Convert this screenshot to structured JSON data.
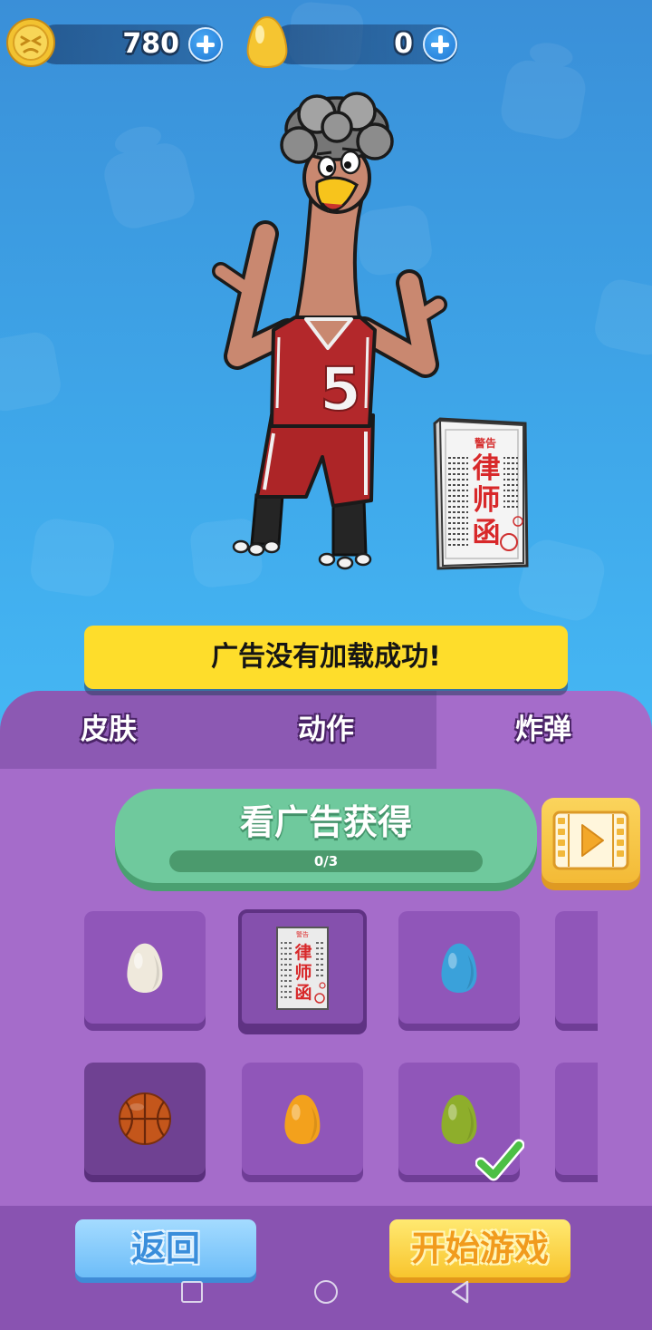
{
  "status_bar": {
    "coins": {
      "value": "780",
      "icon": "coin-icon"
    },
    "eggs": {
      "value": "0",
      "icon": "gold-egg-icon"
    },
    "add_icon": "plus-icon"
  },
  "character": {
    "jersey_number": "5"
  },
  "preview_item": {
    "header": "警告",
    "title_chars": [
      "律",
      "师",
      "函"
    ]
  },
  "banner": {
    "message": "广告没有加载成功!"
  },
  "tabs": [
    {
      "label": "皮肤",
      "selected": false
    },
    {
      "label": "动作",
      "selected": false
    },
    {
      "label": "炸弹",
      "selected": true
    }
  ],
  "ad_reward": {
    "label": "看广告获得",
    "progress_text": "0/3",
    "progress_fraction": 0,
    "video_icon": "video-play-icon"
  },
  "items": [
    {
      "kind": "egg",
      "color": "#efe9dc",
      "selected": false,
      "dark": false,
      "checked": false
    },
    {
      "kind": "lawyer-letter",
      "selected": true,
      "dark": false,
      "checked": false
    },
    {
      "kind": "egg",
      "color": "#3aa1da",
      "selected": false,
      "dark": false,
      "checked": false
    },
    {
      "kind": "partial"
    },
    {
      "kind": "basketball",
      "color": "#c4561b",
      "selected": false,
      "dark": true,
      "checked": false
    },
    {
      "kind": "egg",
      "color": "#f3a11c",
      "selected": false,
      "dark": false,
      "checked": false
    },
    {
      "kind": "egg",
      "color": "#8eae2b",
      "selected": false,
      "dark": false,
      "checked": true
    },
    {
      "kind": "partial"
    }
  ],
  "footer": {
    "back_label": "返回",
    "start_label": "开始游戏"
  },
  "system_nav": {
    "icons": [
      "recent-apps-icon",
      "home-icon",
      "back-icon"
    ]
  },
  "colors": {
    "sky": "#3fa6e8",
    "panel": "#a56cca",
    "tab_inactive": "#8c59b3",
    "banner": "#fedd2b",
    "ad_button": "#6fc99d",
    "jersey": "#b3282b",
    "check": "#4cbf45"
  }
}
